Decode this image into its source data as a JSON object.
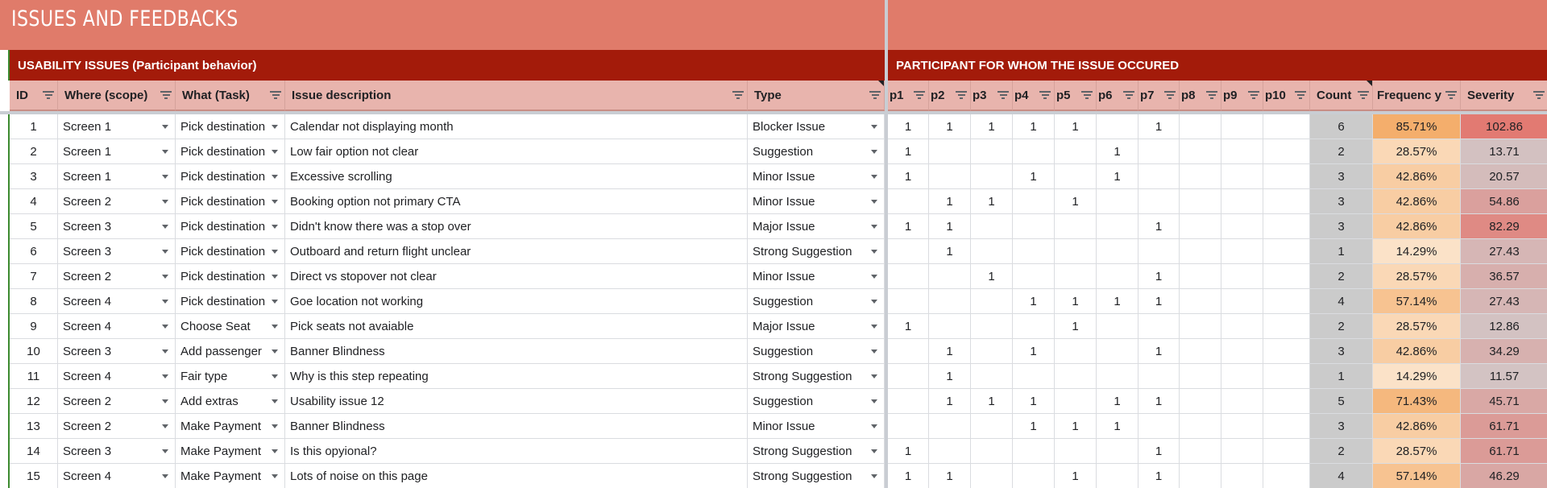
{
  "sheet": {
    "title": "ISSUES AND FEEDBACKS",
    "left_section": "USABILITY ISSUES (Participant behavior)",
    "right_section": "PARTICIPANT FOR WHOM THE ISSUE OCCURED"
  },
  "headers": {
    "id": "ID",
    "where": "Where (scope)",
    "what": "What (Task)",
    "desc": "Issue description",
    "type": "Type",
    "participants": [
      "p1",
      "p2",
      "p3",
      "p4",
      "p5",
      "p6",
      "p7",
      "p8",
      "p9",
      "p10"
    ],
    "count": "Count",
    "frequency": "Frequenc y",
    "severity": "Severity"
  },
  "colors": {
    "title_band": "#e07b6a",
    "section_bar": "#a31b0a",
    "header_fill": "#e8b4ad",
    "count_fill": "#cbcbcb",
    "freq_low": "#fbe2c8",
    "freq_high": "#f4ae6c",
    "sev_low": "#d3c3c3",
    "sev_high": "#e27a72"
  },
  "rows": [
    {
      "id": "1",
      "where": "Screen 1",
      "what": "Pick destination",
      "desc": "Calendar not displaying month",
      "type": "Blocker Issue",
      "p": [
        "1",
        "1",
        "1",
        "1",
        "1",
        "",
        "1",
        "",
        "",
        ""
      ],
      "count": "6",
      "frequency": "85.71%",
      "severity": "102.86"
    },
    {
      "id": "2",
      "where": "Screen 1",
      "what": "Pick destination",
      "desc": "Low fair option not clear",
      "type": "Suggestion",
      "p": [
        "1",
        "",
        "",
        "",
        "",
        "1",
        "",
        "",
        "",
        ""
      ],
      "count": "2",
      "frequency": "28.57%",
      "severity": "13.71"
    },
    {
      "id": "3",
      "where": "Screen 1",
      "what": "Pick destination",
      "desc": "Excessive scrolling",
      "type": "Minor Issue",
      "p": [
        "1",
        "",
        "",
        "1",
        "",
        "1",
        "",
        "",
        "",
        ""
      ],
      "count": "3",
      "frequency": "42.86%",
      "severity": "20.57"
    },
    {
      "id": "4",
      "where": "Screen 2",
      "what": "Pick destination",
      "desc": "Booking option not primary CTA",
      "type": "Minor Issue",
      "p": [
        "",
        "1",
        "1",
        "",
        "1",
        "",
        "",
        "",
        "",
        ""
      ],
      "count": "3",
      "frequency": "42.86%",
      "severity": "54.86"
    },
    {
      "id": "5",
      "where": "Screen 3",
      "what": "Pick destination",
      "desc": "Didn't know there was a stop over",
      "type": "Major Issue",
      "p": [
        "1",
        "1",
        "",
        "",
        "",
        "",
        "1",
        "",
        "",
        ""
      ],
      "count": "3",
      "frequency": "42.86%",
      "severity": "82.29"
    },
    {
      "id": "6",
      "where": "Screen 3",
      "what": "Pick destination",
      "desc": "Outboard and return flight unclear",
      "type": "Strong Suggestion",
      "p": [
        "",
        "1",
        "",
        "",
        "",
        "",
        "",
        "",
        "",
        ""
      ],
      "count": "1",
      "frequency": "14.29%",
      "severity": "27.43"
    },
    {
      "id": "7",
      "where": "Screen 2",
      "what": "Pick destination",
      "desc": "Direct vs stopover not clear",
      "type": "Minor Issue",
      "p": [
        "",
        "",
        "1",
        "",
        "",
        "",
        "1",
        "",
        "",
        ""
      ],
      "count": "2",
      "frequency": "28.57%",
      "severity": "36.57"
    },
    {
      "id": "8",
      "where": "Screen 4",
      "what": "Pick destination",
      "desc": "Goe location not working",
      "type": "Suggestion",
      "p": [
        "",
        "",
        "",
        "1",
        "1",
        "1",
        "1",
        "",
        "",
        ""
      ],
      "count": "4",
      "frequency": "57.14%",
      "severity": "27.43"
    },
    {
      "id": "9",
      "where": "Screen 4",
      "what": "Choose Seat",
      "desc": "Pick seats not avaiable",
      "type": "Major Issue",
      "p": [
        "1",
        "",
        "",
        "",
        "1",
        "",
        "",
        "",
        "",
        ""
      ],
      "count": "2",
      "frequency": "28.57%",
      "severity": "12.86"
    },
    {
      "id": "10",
      "where": "Screen 3",
      "what": "Add passenger",
      "desc": "Banner Blindness",
      "type": "Suggestion",
      "p": [
        "",
        "1",
        "",
        "1",
        "",
        "",
        "1",
        "",
        "",
        ""
      ],
      "count": "3",
      "frequency": "42.86%",
      "severity": "34.29"
    },
    {
      "id": "11",
      "where": "Screen 4",
      "what": "Fair type",
      "desc": "Why is this step repeating",
      "type": "Strong Suggestion",
      "p": [
        "",
        "1",
        "",
        "",
        "",
        "",
        "",
        "",
        "",
        ""
      ],
      "count": "1",
      "frequency": "14.29%",
      "severity": "11.57"
    },
    {
      "id": "12",
      "where": "Screen 2",
      "what": "Add extras",
      "desc": "Usability issue 12",
      "type": "Suggestion",
      "p": [
        "",
        "1",
        "1",
        "1",
        "",
        "1",
        "1",
        "",
        "",
        ""
      ],
      "count": "5",
      "frequency": "71.43%",
      "severity": "45.71"
    },
    {
      "id": "13",
      "where": "Screen 2",
      "what": "Make Payment",
      "desc": "Banner Blindness",
      "type": "Minor Issue",
      "p": [
        "",
        "",
        "",
        "1",
        "1",
        "1",
        "",
        "",
        "",
        ""
      ],
      "count": "3",
      "frequency": "42.86%",
      "severity": "61.71"
    },
    {
      "id": "14",
      "where": "Screen 3",
      "what": "Make Payment",
      "desc": "Is this opyional?",
      "type": "Strong Suggestion",
      "p": [
        "1",
        "",
        "",
        "",
        "",
        "",
        "1",
        "",
        "",
        ""
      ],
      "count": "2",
      "frequency": "28.57%",
      "severity": "61.71"
    },
    {
      "id": "15",
      "where": "Screen 4",
      "what": "Make Payment",
      "desc": "Lots of noise on this page",
      "type": "Strong Suggestion",
      "p": [
        "1",
        "1",
        "",
        "",
        "1",
        "",
        "1",
        "",
        "",
        ""
      ],
      "count": "4",
      "frequency": "57.14%",
      "severity": "46.29"
    }
  ]
}
